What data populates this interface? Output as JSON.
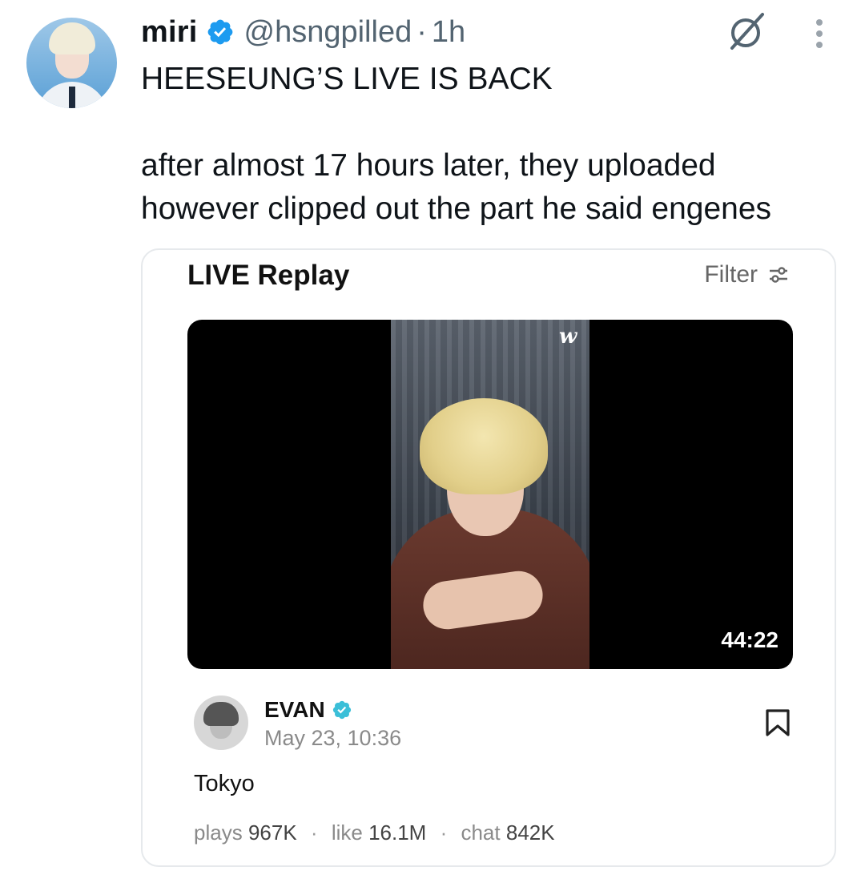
{
  "tweet": {
    "author_name": "miri",
    "handle": "@hsngpilled",
    "separator": "·",
    "time": "1h",
    "text_lines": [
      "HEESEUNG’S LIVE IS BACK",
      "",
      "after almost 17 hours later, they uploaded",
      "however clipped out the part he said engenes"
    ],
    "icons": {
      "verified": "verified-badge-icon",
      "grok": "grok-icon",
      "more": "more-options-icon"
    },
    "colors": {
      "verified": "#1d9bf0",
      "secondary_text": "#536471"
    }
  },
  "card": {
    "title": "LIVE Replay",
    "filter_label": "Filter",
    "video": {
      "platform_logo": "w",
      "duration": "44:22"
    },
    "author": {
      "name": "EVAN",
      "date": "May 23, 10:36"
    },
    "caption": "Tokyo",
    "stats": {
      "plays_label": "plays",
      "plays_value": "967K",
      "like_label": "like",
      "like_value": "16.1M",
      "chat_label": "chat",
      "chat_value": "842K",
      "separator": "·"
    },
    "colors": {
      "verified": "#3bbfd8"
    }
  }
}
